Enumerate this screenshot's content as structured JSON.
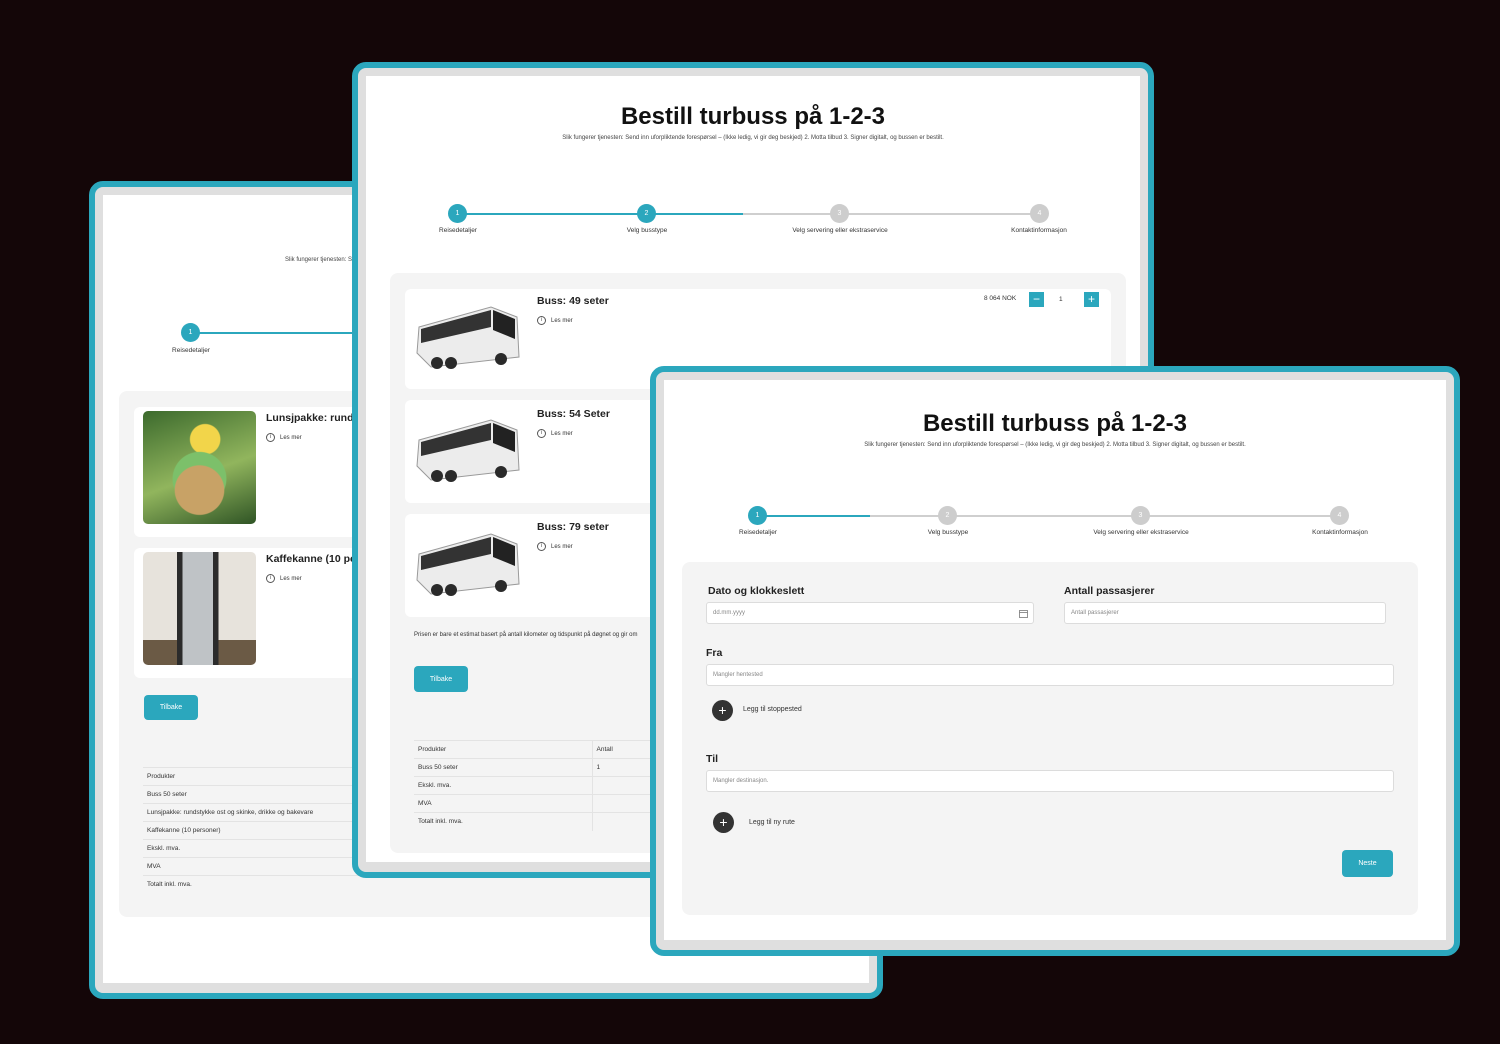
{
  "back_window": {
    "subtitle": "Slik fungerer tjenesten: Se",
    "steps": [
      {
        "number": "1",
        "label": "Reisedetaljer"
      }
    ],
    "products": [
      {
        "title": "Lunsjpakke: runds",
        "more": "Les mer"
      },
      {
        "title": "Kaffekanne (10 pe",
        "more": "Les mer"
      }
    ],
    "back_button": "Tilbake",
    "table_rows": [
      "Produkter",
      "Buss 50 seter",
      "Lunsjpakke: rundstykke ost og skinke, drikke og bakevare",
      "Kaffekanne (10 personer)",
      "Ekskl. mva.",
      "MVA",
      "Totalt inkl. mva."
    ]
  },
  "middle_window": {
    "title": "Bestill turbuss på 1-2-3",
    "subtitle": "Slik fungerer tjenesten: Send inn uforpliktende forespørsel – (Ikke ledig, vi gir deg beskjed) 2. Motta tilbud 3. Signer digitalt, og bussen er bestilt.",
    "steps": [
      {
        "number": "1",
        "label": "Reisedetaljer"
      },
      {
        "number": "2",
        "label": "Velg busstype"
      },
      {
        "number": "3",
        "label": "Velg servering eller ekstraservice"
      },
      {
        "number": "4",
        "label": "Kontaktinformasjon"
      }
    ],
    "buses": [
      {
        "title": "Buss: 49 seter",
        "more": "Les mer"
      },
      {
        "title": "Buss: 54 Seter",
        "more": "Les mer"
      },
      {
        "title": "Buss: 79 seter",
        "more": "Les mer"
      }
    ],
    "price": "8 064 NOK",
    "quantity": "1",
    "note": "Prisen er bare et estimat basert på antall kilometer og tidspunkt på døgnet og gir om",
    "back_button": "Tilbake",
    "table_headers": [
      "Produkter",
      "Antall"
    ],
    "table_rows": [
      [
        "Buss 50 seter",
        "1"
      ],
      [
        "Ekskl. mva.",
        ""
      ],
      [
        "MVA",
        ""
      ],
      [
        "Totalt inkl. mva.",
        ""
      ]
    ]
  },
  "front_window": {
    "title": "Bestill turbuss på 1-2-3",
    "subtitle": "Slik fungerer tjenesten: Send inn uforpliktende forespørsel – (Ikke ledig, vi gir deg beskjed) 2. Motta tilbud 3. Signer digitalt, og bussen er bestilt.",
    "steps": [
      {
        "number": "1",
        "label": "Reisedetaljer"
      },
      {
        "number": "2",
        "label": "Velg busstype"
      },
      {
        "number": "3",
        "label": "Velg servering eller ekstraservice"
      },
      {
        "number": "4",
        "label": "Kontaktinformasjon"
      }
    ],
    "date_label": "Dato og klokkeslett",
    "date_placeholder": "dd.mm.yyyy",
    "passengers_label": "Antall passasjerer",
    "passengers_placeholder": "Antall passasjerer",
    "from_label": "Fra",
    "from_placeholder": "Mangler hentested",
    "add_stop": "Legg til stoppested",
    "to_label": "Til",
    "to_placeholder": "Mangler destinasjon.",
    "add_route": "Legg til ny rute",
    "next_button": "Neste"
  },
  "colors": {
    "accent": "#2ba7bd",
    "background": "#140608",
    "panel": "#f4f4f4"
  }
}
